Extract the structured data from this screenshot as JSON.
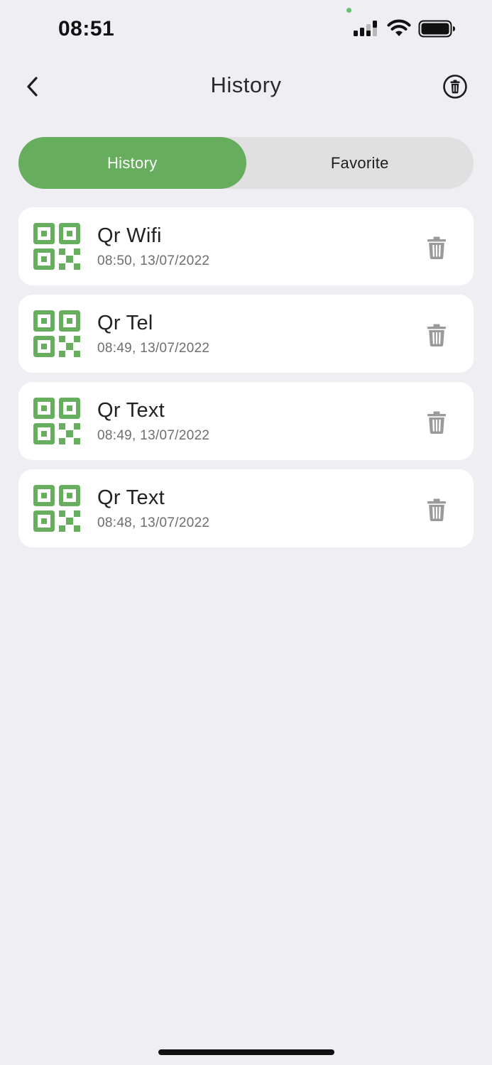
{
  "status_bar": {
    "time": "08:51",
    "icons": [
      "signal-icon",
      "wifi-icon",
      "battery-icon"
    ]
  },
  "nav": {
    "title": "History",
    "back_icon": "chevron-left-icon",
    "clear_icon": "trash-circle-icon"
  },
  "tabs": [
    {
      "label": "History",
      "active": true
    },
    {
      "label": "Favorite",
      "active": false
    }
  ],
  "items": [
    {
      "title": "Qr Wifi",
      "time": "08:50, 13/07/2022",
      "icon": "qr-code-icon"
    },
    {
      "title": "Qr Tel",
      "time": "08:49, 13/07/2022",
      "icon": "qr-code-icon"
    },
    {
      "title": "Qr Text",
      "time": "08:49, 13/07/2022",
      "icon": "qr-code-icon"
    },
    {
      "title": "Qr Text",
      "time": "08:48, 13/07/2022",
      "icon": "qr-code-icon"
    }
  ],
  "colors": {
    "accent": "#66ad5e",
    "background": "#efeef3",
    "card": "#ffffff",
    "tab_track": "#e0e0e0",
    "delete_icon": "#9a9a9a"
  }
}
